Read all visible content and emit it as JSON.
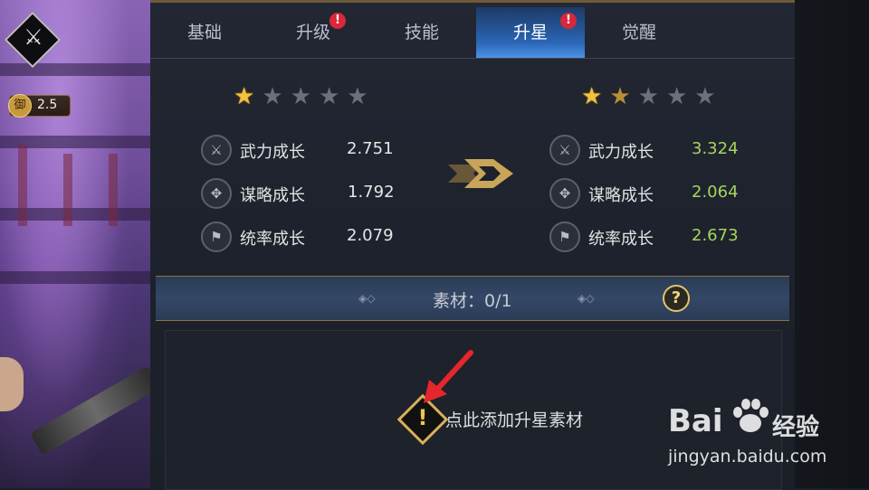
{
  "hero": {
    "level": "2.5",
    "level_icon_char": "御"
  },
  "tabs": [
    {
      "label": "基础",
      "active": false,
      "alert": false
    },
    {
      "label": "升级",
      "active": false,
      "alert": true
    },
    {
      "label": "技能",
      "active": false,
      "alert": false
    },
    {
      "label": "升星",
      "active": true,
      "alert": true
    },
    {
      "label": "觉醒",
      "active": false,
      "alert": false
    }
  ],
  "alert_mark": "!",
  "current": {
    "stars": [
      "gold",
      "gray",
      "gray",
      "gray",
      "gray"
    ],
    "stats": [
      {
        "label": "武力成长",
        "value": "2.751",
        "icon": "sword-icon"
      },
      {
        "label": "谋略成长",
        "value": "1.792",
        "icon": "strategy-icon"
      },
      {
        "label": "统率成长",
        "value": "2.079",
        "icon": "flag-icon"
      }
    ]
  },
  "next": {
    "stars": [
      "gold",
      "bronze",
      "gray",
      "gray",
      "gray"
    ],
    "stats": [
      {
        "label": "武力成长",
        "value": "3.324",
        "icon": "sword-icon"
      },
      {
        "label": "谋略成长",
        "value": "2.064",
        "icon": "strategy-icon"
      },
      {
        "label": "统率成长",
        "value": "2.673",
        "icon": "flag-icon"
      }
    ]
  },
  "material": {
    "label": "素材：0/1",
    "help": "?"
  },
  "add_material": {
    "icon_char": "!",
    "text": "点此添加升星素材"
  },
  "watermark": {
    "logo": "Bai",
    "brand": "经验",
    "url": "jingyan.baidu.com"
  },
  "colors": {
    "value_normal": "#e6e6e6",
    "value_upgrade": "#a4d65e",
    "accent_gold": "#e3c36a",
    "tab_active": "#2a66b5",
    "alert": "#d8283a"
  }
}
